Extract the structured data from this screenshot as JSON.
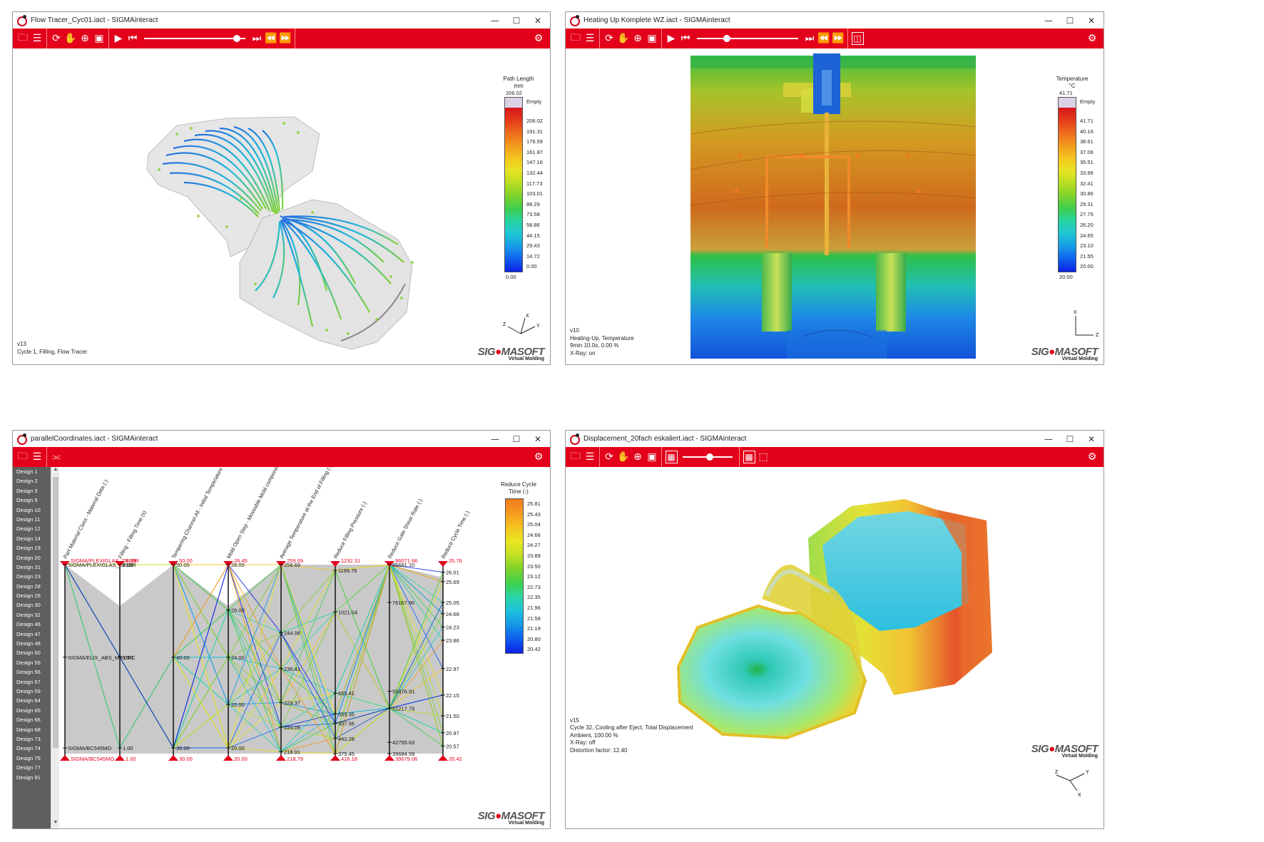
{
  "windows": {
    "flow": {
      "title": "Flow Tracer_Cyc01.iact - SIGMAinteract",
      "view_label": "v13",
      "info": [
        "Cycle 1, Filling, Flow Tracer"
      ],
      "slider_value": 0.95,
      "legend": {
        "title": [
          "Path Length",
          "mm"
        ],
        "max": "206.02",
        "empty": "Empty",
        "ticks": [
          "206.02",
          "191.31",
          "176.59",
          "161.87",
          "147.16",
          "132.44",
          "117.73",
          "103.01",
          "88.29",
          "73.58",
          "58.86",
          "44.15",
          "29.43",
          "14.72",
          "0.00"
        ],
        "min": "0.00"
      },
      "axes": {
        "x": "X",
        "y": "Y",
        "z": "Z"
      }
    },
    "heat": {
      "title": "Heating Up Komplete WZ.iact - SIGMAinteract",
      "view_label": "v10",
      "info": [
        "Heating-Up, Temperature",
        "9min 10.0s, 0.00 %",
        "X-Ray: on"
      ],
      "slider_value": 0.28,
      "legend": {
        "title": [
          "Temperature",
          "°C"
        ],
        "max": "41.71",
        "empty": "Empty",
        "ticks": [
          "41.71",
          "40.16",
          "38.61",
          "37.06",
          "35.51",
          "33.96",
          "32.41",
          "30.86",
          "29.31",
          "27.75",
          "26.20",
          "24.65",
          "23.10",
          "21.55",
          "20.00"
        ],
        "min": "20.00"
      },
      "axes": {
        "x": "X",
        "z": "Z"
      }
    },
    "parallel": {
      "title": "parallelCoordinates.iact - SIGMAinteract",
      "designs": [
        "Design 1",
        "Design 2",
        "Design 3",
        "Design 5",
        "Design 10",
        "Design 11",
        "Design 12",
        "Design 14",
        "Design 19",
        "Design 20",
        "Design 21",
        "Design 23",
        "Design 28",
        "Design 29",
        "Design 30",
        "Design 32",
        "Design 46",
        "Design 47",
        "Design 48",
        "Design 50",
        "Design 55",
        "Design 56",
        "Design 57",
        "Design 59",
        "Design 64",
        "Design 65",
        "Design 66",
        "Design 68",
        "Design 73",
        "Design 74",
        "Design 75",
        "Design 77",
        "Design 91"
      ],
      "legend": {
        "title": [
          "Reduce Cycle",
          "Time (-)"
        ],
        "ticks": [
          "25.81",
          "25.43",
          "25.04",
          "24.66",
          "24.27",
          "23.89",
          "23.50",
          "23.12",
          "22.73",
          "22.35",
          "21.96",
          "21.58",
          "21.19",
          "20.80",
          "20.42"
        ]
      }
    },
    "disp": {
      "title": "Displacement_20fach eskaliert.iact - SIGMAinteract",
      "view_label": "v15",
      "info": [
        "Cycle 32, Cooling after Eject, Total Displacement",
        "Ambient, 100.00 %",
        "X-Ray: off",
        "Distortion factor: 12.40"
      ],
      "slider_value": 0.55,
      "axes": {
        "x": "X",
        "y": "Y",
        "z": "Z"
      }
    }
  },
  "brand": {
    "name_a": "SIG",
    "name_b": "MASOFT",
    "tagline": "Virtual Molding"
  },
  "colors": {
    "accent": "#e3001b",
    "panel": "#5f5f5f"
  },
  "chart_data": {
    "type": "parallel-coordinates",
    "axes": [
      {
        "label": "Part Material Class - Material Data (-)",
        "top": "SIGMA/PLEXIGLAS_ZK6BR",
        "bottom": "SIGMA/BC545MO",
        "ticks": [
          {
            "v": "SIGMA/PLEXIGLAS_ZK6BR",
            "p": 0.0
          },
          {
            "v": "SIGMA/ELIX_ABS_M205FC",
            "p": 0.49
          },
          {
            "v": "SIGMA/BC545MO",
            "p": 0.97
          }
        ]
      },
      {
        "label": "Filling - Filling Time (s)",
        "top": "3.79",
        "bottom": "1.00",
        "ticks": [
          {
            "v": "2.00",
            "p": 0.0
          },
          {
            "v": "1.50",
            "p": 0.49
          },
          {
            "v": "1.00",
            "p": 0.97
          }
        ]
      },
      {
        "label": "Tempering Channel All - Initial Temperature (°C)",
        "top": "50.00",
        "bottom": "30.00",
        "ticks": [
          {
            "v": "50.00",
            "p": 0.0
          },
          {
            "v": "40.00",
            "p": 0.49
          },
          {
            "v": "30.00",
            "p": 0.97
          }
        ]
      },
      {
        "label": "Mold Open Step - Moveable Mold components - Time (s)",
        "top": "26.45",
        "bottom": "20.00",
        "ticks": [
          {
            "v": "28.00",
            "p": 0.0
          },
          {
            "v": "26.00",
            "p": 0.24
          },
          {
            "v": "24.00",
            "p": 0.49
          },
          {
            "v": "22.00",
            "p": 0.74
          },
          {
            "v": "20.00",
            "p": 0.97
          }
        ]
      },
      {
        "label": "Average Temperature at the End of Filling (-)",
        "top": "259.09",
        "bottom": "218.79",
        "ticks": [
          {
            "v": "258.69",
            "p": 0.0
          },
          {
            "v": "244.08",
            "p": 0.36
          },
          {
            "v": "236.41",
            "p": 0.55
          },
          {
            "v": "229.37",
            "p": 0.73
          },
          {
            "v": "224.09",
            "p": 0.86
          },
          {
            "v": "218.91",
            "p": 0.99
          }
        ]
      },
      {
        "label": "Reduce Filling Pressure (-)",
        "top": "1232.31",
        "bottom": "416.18",
        "ticks": [
          {
            "v": "1199.76",
            "p": 0.03
          },
          {
            "v": "1021.04",
            "p": 0.25
          },
          {
            "v": "655.41",
            "p": 0.68
          },
          {
            "v": "555.35",
            "p": 0.79
          },
          {
            "v": "507.56",
            "p": 0.84
          },
          {
            "v": "442.28",
            "p": 0.92
          },
          {
            "v": "375.45",
            "p": 1.0
          }
        ]
      },
      {
        "label": "Reduce Gate Shear Rate (-)",
        "top": "86071.66",
        "bottom": "39679.06",
        "ticks": [
          {
            "v": "85681.10",
            "p": 0.0
          },
          {
            "v": "76167.90",
            "p": 0.2
          },
          {
            "v": "55476.91",
            "p": 0.67
          },
          {
            "v": "51217.79",
            "p": 0.76
          },
          {
            "v": "42755.63",
            "p": 0.94
          },
          {
            "v": "39684.59",
            "p": 1.0
          }
        ]
      },
      {
        "label": "Reduce Cycle Time (-)",
        "top": "25.76",
        "bottom": "20.42",
        "ticks": [
          {
            "v": "26.01",
            "p": 0.04
          },
          {
            "v": "25.69",
            "p": 0.09
          },
          {
            "v": "25.05",
            "p": 0.2
          },
          {
            "v": "24.68",
            "p": 0.26
          },
          {
            "v": "24.23",
            "p": 0.33
          },
          {
            "v": "23.86",
            "p": 0.4
          },
          {
            "v": "22.97",
            "p": 0.55
          },
          {
            "v": "22.15",
            "p": 0.69
          },
          {
            "v": "21.50",
            "p": 0.8
          },
          {
            "v": "20.97",
            "p": 0.89
          },
          {
            "v": "20.57",
            "p": 0.96
          }
        ]
      }
    ]
  }
}
